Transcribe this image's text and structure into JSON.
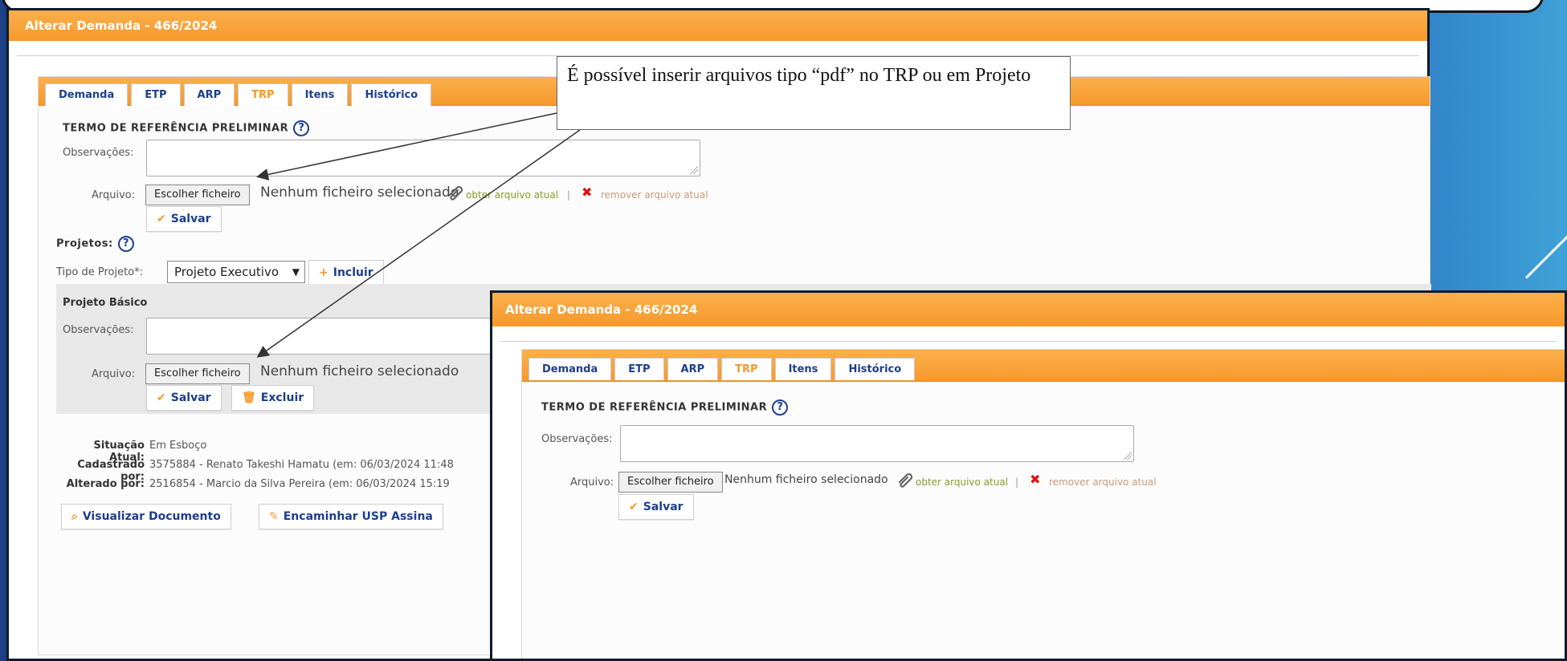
{
  "window": {
    "title": "Alterar Demanda - 466/2024"
  },
  "tabs": [
    {
      "label": "Demanda",
      "active": false
    },
    {
      "label": "ETP",
      "active": false
    },
    {
      "label": "ARP",
      "active": false
    },
    {
      "label": "TRP",
      "active": true
    },
    {
      "label": "Itens",
      "active": false
    },
    {
      "label": "Histórico",
      "active": false
    }
  ],
  "trp": {
    "title": "TERMO DE REFERÊNCIA PRELIMINAR",
    "obs_label": "Observações:",
    "file_label": "Arquivo:",
    "file_button": "Escolher ficheiro",
    "file_status": "Nenhum ficheiro selecionado",
    "get_file_link": "obter arquivo atual",
    "separator": "|",
    "remove_file_link": "remover arquivo atual",
    "save_button": "Salvar"
  },
  "projetos": {
    "title": "Projetos:",
    "type_label": "Tipo de Projeto*:",
    "type_selected": "Projeto Executivo",
    "include_button": "Incluir",
    "basic": {
      "title": "Projeto Básico",
      "obs_label": "Observações:",
      "file_label": "Arquivo:",
      "file_button": "Escolher ficheiro",
      "file_status": "Nenhum ficheiro selecionado",
      "save_button": "Salvar",
      "delete_button": "Excluir"
    }
  },
  "info": {
    "situation_label": "Situação Atual:",
    "situation_value": "Em Esboço",
    "created_label": "Cadastrado por:",
    "created_value": "3575884 - Renato Takeshi Hamatu (em: 06/03/2024 11:48",
    "changed_label": "Alterado por:",
    "changed_value": "2516854 - Marcio da Silva Pereira (em: 06/03/2024 15:19"
  },
  "actions": {
    "view_document": "Visualizar Documento",
    "forward": "Encaminhar USP Assina"
  },
  "callout": {
    "text": "É possível inserir arquivos tipo “pdf” no TRP ou em Projeto"
  },
  "colors": {
    "orange": "#f7982b",
    "navy_text": "#1d3e8e",
    "slide_blue": "#214b95",
    "link_green": "#8a9a2a",
    "remove_red": "#dd1111"
  },
  "icons": {
    "help": "help-circle-icon",
    "check": "check-icon",
    "plus": "plus-icon",
    "trash": "trash-icon",
    "search": "search-icon",
    "pencil": "pencil-icon",
    "paperclip": "paperclip-icon",
    "remove": "x-icon",
    "dropdown": "chevron-down-icon"
  }
}
